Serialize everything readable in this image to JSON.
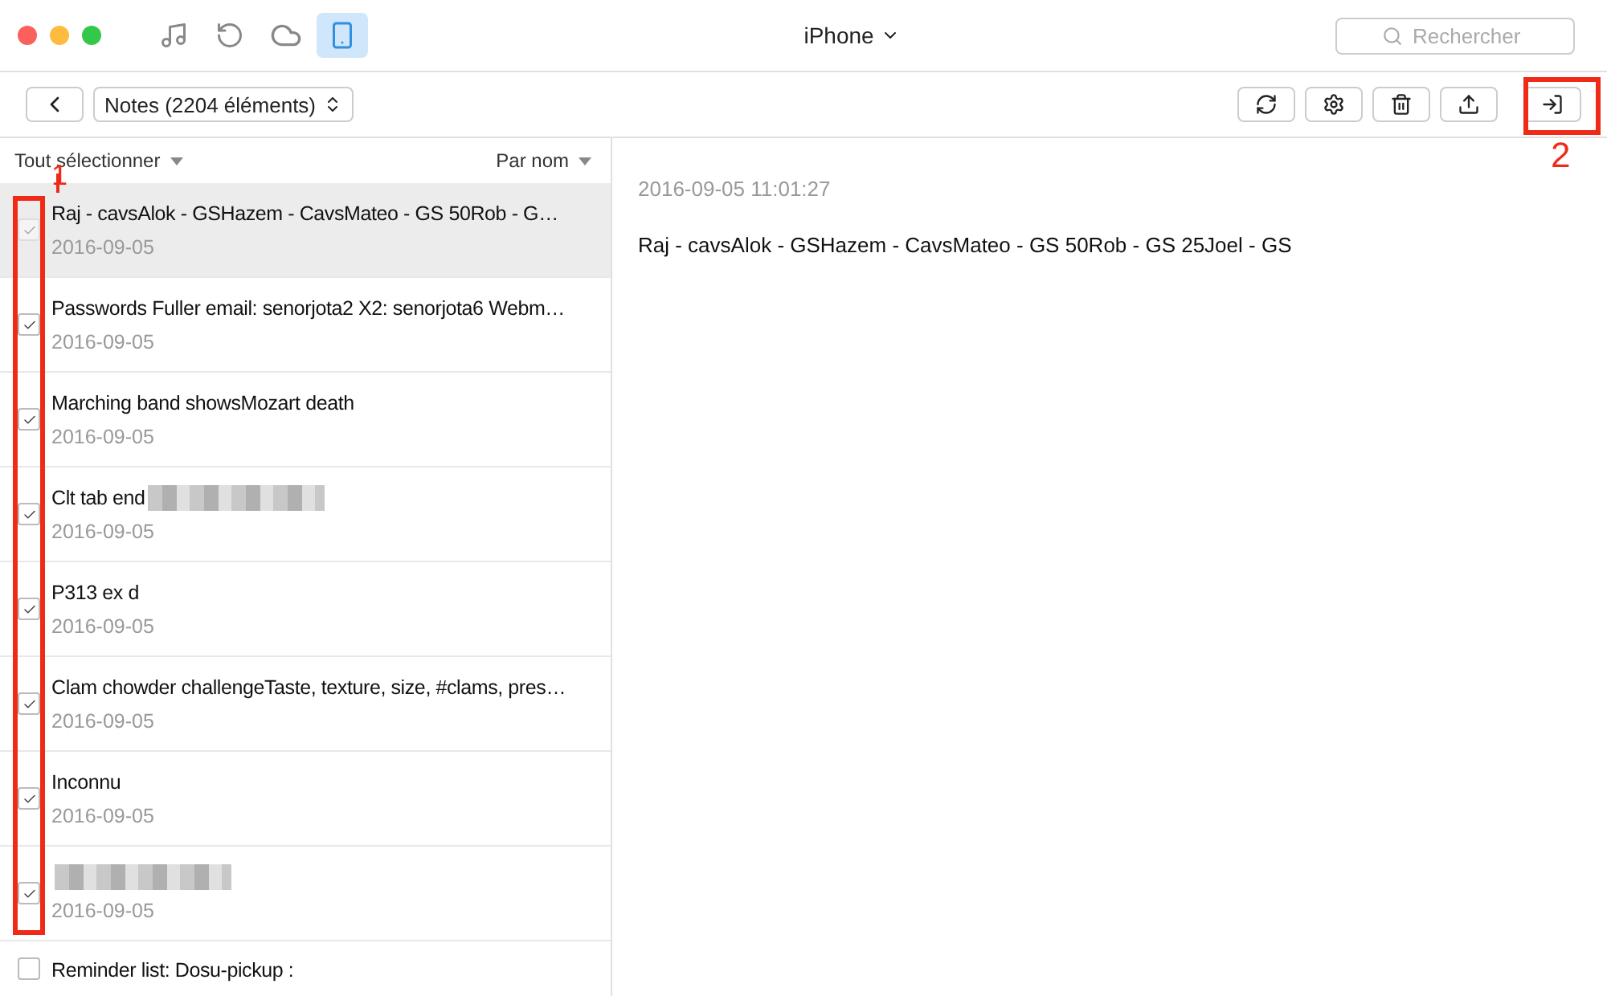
{
  "window": {
    "title": "iPhone",
    "search": {
      "placeholder": "Rechercher"
    },
    "nav_icons": [
      {
        "kind": "music",
        "selected": false
      },
      {
        "kind": "restore",
        "selected": false
      },
      {
        "kind": "cloud",
        "selected": false
      },
      {
        "kind": "phone",
        "selected": true
      }
    ]
  },
  "toolbar": {
    "category": "Notes (2204 éléments)",
    "actions": [
      {
        "kind": "refresh"
      },
      {
        "kind": "settings"
      },
      {
        "kind": "delete"
      },
      {
        "kind": "export"
      },
      {
        "kind": "import"
      }
    ]
  },
  "list": {
    "select_all": "Tout sélectionner",
    "sort": "Par nom",
    "rows": [
      {
        "title": "Raj - cavsAlok - GSHazem - CavsMateo - GS 50Rob - G…",
        "date": "2016-09-05",
        "checked": true,
        "selected": true
      },
      {
        "title": "Passwords Fuller email: senorjota2 X2: senorjota6 Webm…",
        "date": "2016-09-05",
        "checked": true,
        "selected": false
      },
      {
        "title": "Marching band showsMozart death",
        "date": "2016-09-05",
        "checked": true,
        "selected": false
      },
      {
        "title": "Clt tab end",
        "redacted": true,
        "date": "2016-09-05",
        "checked": true,
        "selected": false
      },
      {
        "title": "P313 ex d",
        "date": "2016-09-05",
        "checked": true,
        "selected": false
      },
      {
        "title": "Clam chowder challengeTaste, texture, size, #clams, pres…",
        "date": "2016-09-05",
        "checked": true,
        "selected": false
      },
      {
        "title": "Inconnu",
        "date": "2016-09-05",
        "checked": true,
        "selected": false
      },
      {
        "redacted": true,
        "date": "2016-09-05",
        "checked": true,
        "selected": false
      },
      {
        "title": "Reminder list: Dosu-pickup :",
        "checked": false,
        "selected": false
      }
    ]
  },
  "detail": {
    "timestamp": "2016-09-05 11:01:27",
    "body": "Raj - cavsAlok - GSHazem - CavsMateo - GS 50Rob - GS 25Joel - GS"
  },
  "annotations": [
    {
      "label": "1"
    },
    {
      "label": "2"
    }
  ]
}
